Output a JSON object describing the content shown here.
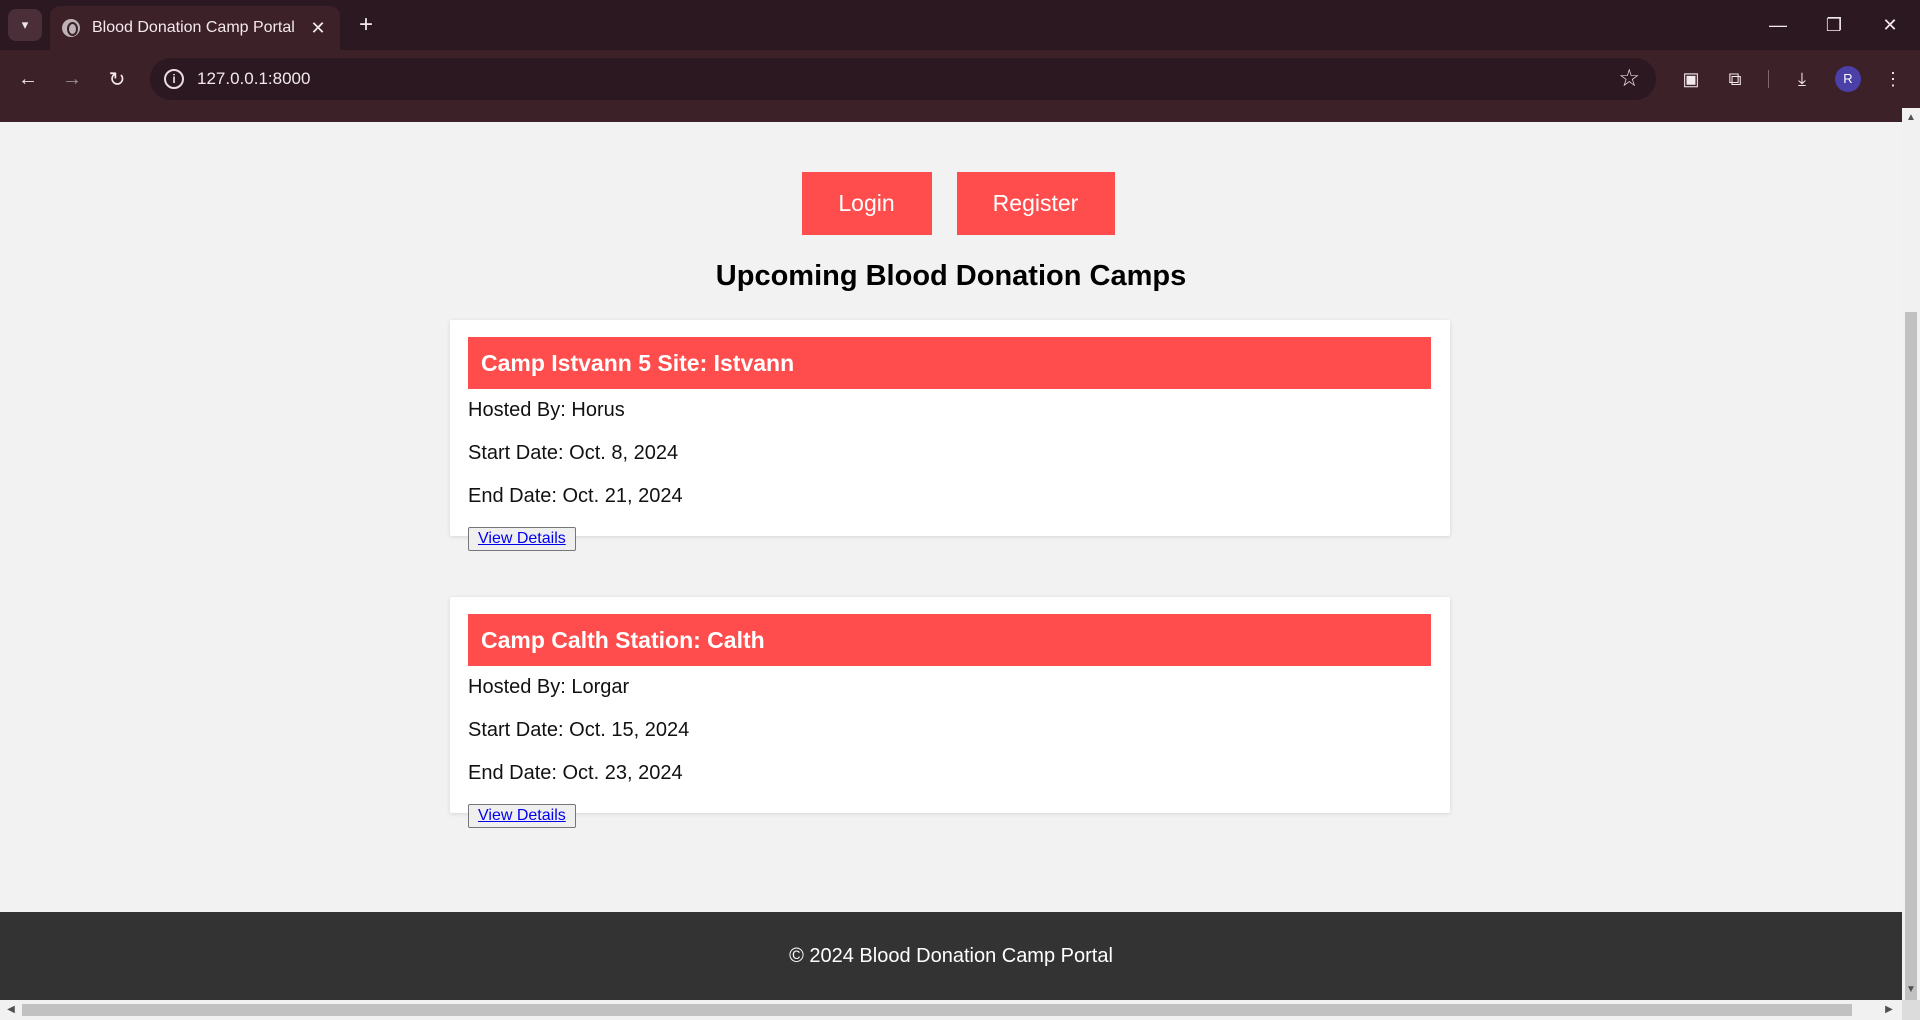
{
  "browser": {
    "tab_title": "Blood Donation Camp Portal",
    "url": "127.0.0.1:8000",
    "profile_initial": "R",
    "icons": {
      "tab_menu": "chevron-down-icon",
      "favicon": "globe-icon",
      "tab_close": "close-icon",
      "new_tab": "plus-icon",
      "minimize": "minimize-icon",
      "restore": "restore-icon",
      "close_window": "close-icon",
      "back": "arrow-left-icon",
      "forward": "arrow-right-icon",
      "reload": "reload-icon",
      "site_info": "info-icon",
      "bookmark": "star-icon",
      "media": "media-icon",
      "extensions": "puzzle-icon",
      "downloads": "download-icon",
      "menu": "kebab-menu-icon"
    }
  },
  "page": {
    "nav": {
      "login_label": "Login",
      "register_label": "Register"
    },
    "heading": "Upcoming Blood Donation Camps",
    "camps": [
      {
        "title": "Camp Istvann 5 Site: Istvann",
        "hosted_by": "Hosted By: Horus",
        "start_date": "Start Date: Oct. 8, 2024",
        "end_date": "End Date: Oct. 21, 2024",
        "button_label": "View Details"
      },
      {
        "title": "Camp Calth Station: Calth",
        "hosted_by": "Hosted By: Lorgar",
        "start_date": "Start Date: Oct. 15, 2024",
        "end_date": "End Date: Oct. 23, 2024",
        "button_label": "View Details"
      }
    ],
    "footer": "© 2024 Blood Donation Camp Portal"
  },
  "colors": {
    "accent": "#ff4d4d",
    "page_background": "#f2f2f2",
    "footer_background": "#333333",
    "chrome_dark": "#2b1820",
    "chrome": "#3c2129"
  }
}
